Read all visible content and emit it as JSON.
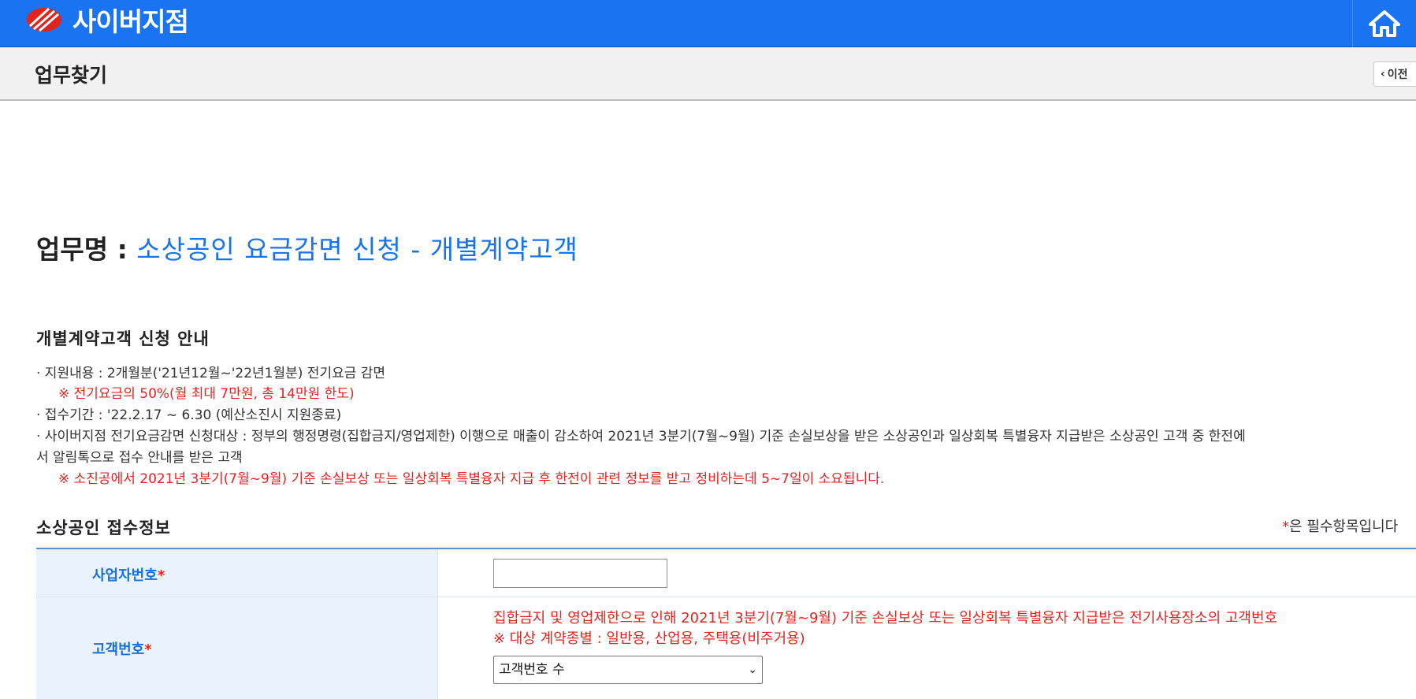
{
  "header": {
    "brand": "사이버지점",
    "icons": {
      "logo": "kepco-logo-icon",
      "home": "home-icon"
    },
    "colors": {
      "bar": "#1a73f0",
      "accent": "#1a73e8",
      "required": "#e52420"
    }
  },
  "subheader": {
    "title": "업무찾기",
    "back_label": "이전"
  },
  "task": {
    "label": "업무명 :",
    "name": "소상공인 요금감면 신청 - 개별계약고객"
  },
  "guide": {
    "title": "개별계약고객 신청 안내",
    "support": "· 지원내용 : 2개월분('21년12월~'22년1월분) 전기요금 감면",
    "support_note": "※ 전기요금의 50%(월 최대 7만원, 총 14만원 한도)",
    "period": "· 접수기간 : '22.2.17 ~ 6.30 (예산소진시 지원종료)",
    "target_line1": "· 사이버지점 전기요금감면 신청대상 : 정부의 행정명령(집합금지/영업제한) 이행으로 매출이 감소하여 2021년 3분기(7월~9월) 기준 손실보상을 받은 소상공인과 일상회복 특별융자 지급받은 소상공인 고객 중 한전에",
    "target_line2": "서 알림톡으로 접수 안내를 받은 고객",
    "target_note": "※ 소진공에서 2021년 3분기(7월~9월) 기준 손실보상 또는 일상회복 특별융자 지급 후 한전이 관련 정보를 받고 정비하는데 5~7일이 소요됩니다."
  },
  "form": {
    "title": "소상공인 접수정보",
    "required_note": "은 필수항목입니다",
    "required_mark": "*",
    "business_number": {
      "label": "사업자번호",
      "value": ""
    },
    "customer_number": {
      "label": "고객번호",
      "desc1": "집합금지 및 영업제한으로 인해 2021년 3분기(7월~9월) 기준 손실보상 또는 일상회복 특별융자 지급받은 전기사용장소의 고객번호",
      "desc2": "※ 대상 계약종별 : 일반용, 산업용, 주택용(비주거용)",
      "select_value": "고객번호 수"
    }
  }
}
